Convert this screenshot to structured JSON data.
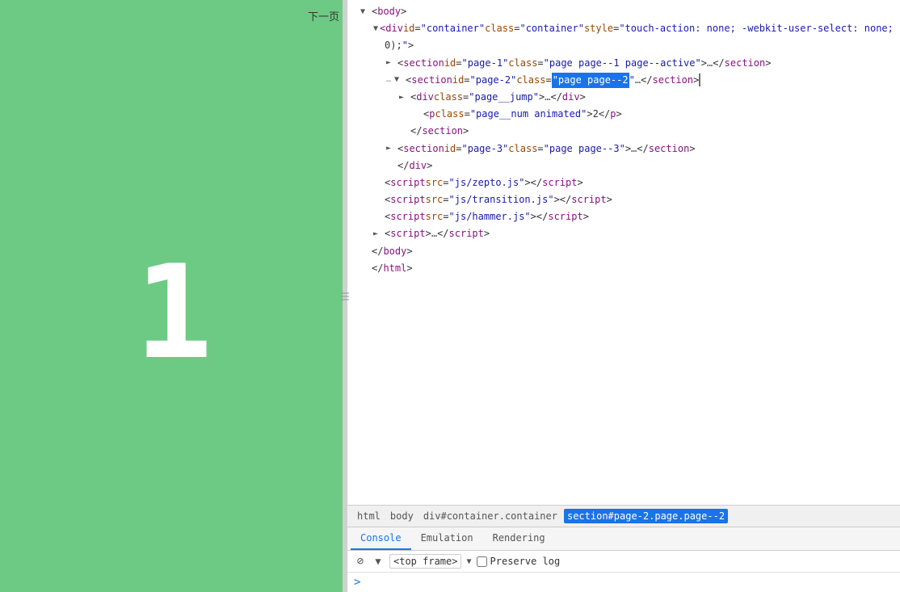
{
  "preview": {
    "background_color": "#6dca84",
    "page_number": "1",
    "next_page_btn": "下一页"
  },
  "devtools": {
    "dom_lines": [
      {
        "id": "line-body",
        "indent": "indent1",
        "triangle": "open",
        "marker": false,
        "html": "<span class='punctuation'>&lt;</span><span class='tag-name'>body</span><span class='punctuation'>&gt;</span>"
      },
      {
        "id": "line-div-container",
        "indent": "indent2",
        "triangle": "open",
        "marker": false,
        "html": "<span class='punctuation'>&lt;</span><span class='tag-name'>div</span> <span class='attr-name'>id</span><span class='punctuation'>=</span><span class='attr-value'>\"container\"</span> <span class='attr-name'>class</span><span class='punctuation'>=</span><span class='attr-value'>\"container\"</span> <span class='attr-name'>style</span><span class='punctuation'>=</span><span class='attr-value'>\"touch-action: none; -webkit-user-select: none; -webki</span>"
      },
      {
        "id": "line-0-close",
        "indent": "indent2",
        "triangle": "empty",
        "marker": false,
        "html": "<span class='punctuation'>0);</span><span class='attr-value'>\"</span><span class='punctuation'>&gt;</span>"
      },
      {
        "id": "line-section1",
        "indent": "indent3",
        "triangle": "closed",
        "marker": false,
        "html": "<span class='punctuation'>&lt;</span><span class='tag-name'>section</span> <span class='attr-name'>id</span><span class='punctuation'>=</span><span class='attr-value'>\"page-1\"</span> <span class='attr-name'>class</span><span class='punctuation'>=</span><span class='attr-value'>\"page page--1 page--active\"</span><span class='punctuation'>&gt;</span><span class='ellipsis'>…</span><span class='punctuation'>&lt;/</span><span class='tag-name'>section</span><span class='punctuation'>&gt;</span>"
      },
      {
        "id": "line-section2",
        "indent": "indent3",
        "triangle": "open",
        "marker": true,
        "html": "<span class='punctuation'>&lt;</span><span class='tag-name'>section</span> <span class='attr-name'>id</span><span class='punctuation'>=</span><span class='attr-value'>\"page-2\"</span> <span class='attr-name'>class</span><span class='punctuation'>=</span><span class='attr-value-highlight'>\"page page--2</span><span class='attr-value'>\"</span><span class='ellipsis'>…</span><span class='punctuation'>&lt;/</span><span class='tag-name'>section</span><span class='punctuation'>&gt;</span>",
        "highlighted": false
      },
      {
        "id": "line-div-jump",
        "indent": "indent4",
        "triangle": "closed",
        "marker": false,
        "html": "<span class='punctuation'>&lt;</span><span class='tag-name'>div</span> <span class='attr-name'>class</span><span class='punctuation'>=</span><span class='attr-value'>\"page__jump\"</span><span class='punctuation'>&gt;</span><span class='ellipsis'>…</span><span class='punctuation'>&lt;/</span><span class='tag-name'>div</span><span class='punctuation'>&gt;</span>"
      },
      {
        "id": "line-p-num",
        "indent": "indent5",
        "triangle": "empty",
        "marker": false,
        "html": "<span class='punctuation'>&lt;</span><span class='tag-name'>p</span> <span class='attr-name'>class</span><span class='punctuation'>=</span><span class='attr-value'>\"page__num animated\"</span><span class='punctuation'>&gt;</span>2<span class='punctuation'>&lt;/</span><span class='tag-name'>p</span><span class='punctuation'>&gt;</span>"
      },
      {
        "id": "line-section-close",
        "indent": "indent4",
        "triangle": "empty",
        "marker": false,
        "html": "<span class='punctuation'>&lt;/</span><span class='tag-name'>section</span><span class='punctuation'>&gt;</span>"
      },
      {
        "id": "line-section3",
        "indent": "indent3",
        "triangle": "closed",
        "marker": false,
        "html": "<span class='punctuation'>&lt;</span><span class='tag-name'>section</span> <span class='attr-name'>id</span><span class='punctuation'>=</span><span class='attr-value'>\"page-3\"</span> <span class='attr-name'>class</span><span class='punctuation'>=</span><span class='attr-value'>\"page page--3\"</span><span class='punctuation'>&gt;</span><span class='ellipsis'>…</span><span class='punctuation'>&lt;/</span><span class='tag-name'>section</span><span class='punctuation'>&gt;</span>"
      },
      {
        "id": "line-div-close",
        "indent": "indent3",
        "triangle": "empty",
        "marker": false,
        "html": "<span class='punctuation'>&lt;/</span><span class='tag-name'>div</span><span class='punctuation'>&gt;</span>"
      },
      {
        "id": "line-script1",
        "indent": "indent2",
        "triangle": "empty",
        "marker": false,
        "html": "<span class='punctuation'>&lt;</span><span class='tag-name'>script</span> <span class='attr-name'>src</span><span class='punctuation'>=</span><span class='attr-value'>\"js/zepto.js\"</span><span class='punctuation'>&gt;&lt;/</span><span class='tag-name'>script</span><span class='punctuation'>&gt;</span>"
      },
      {
        "id": "line-script2",
        "indent": "indent2",
        "triangle": "empty",
        "marker": false,
        "html": "<span class='punctuation'>&lt;</span><span class='tag-name'>script</span> <span class='attr-name'>src</span><span class='punctuation'>=</span><span class='attr-value'>\"js/transition.js\"</span><span class='punctuation'>&gt;&lt;/</span><span class='tag-name'>script</span><span class='punctuation'>&gt;</span>"
      },
      {
        "id": "line-script3",
        "indent": "indent2",
        "triangle": "empty",
        "marker": false,
        "html": "<span class='punctuation'>&lt;</span><span class='tag-name'>script</span> <span class='attr-name'>src</span><span class='punctuation'>=</span><span class='attr-value'>\"js/hammer.js\"</span><span class='punctuation'>&gt;&lt;/</span><span class='tag-name'>script</span><span class='punctuation'>&gt;</span>"
      },
      {
        "id": "line-script4",
        "indent": "indent2",
        "triangle": "closed",
        "marker": false,
        "html": "<span class='punctuation'>&lt;</span><span class='tag-name'>script</span><span class='punctuation'>&gt;</span><span class='ellipsis'>…</span><span class='punctuation'>&lt;/</span><span class='tag-name'>script</span><span class='punctuation'>&gt;</span>"
      },
      {
        "id": "line-body-close",
        "indent": "indent1",
        "triangle": "empty",
        "marker": false,
        "html": "<span class='punctuation'>&lt;/</span><span class='tag-name'>body</span><span class='punctuation'>&gt;</span>"
      },
      {
        "id": "line-html-close",
        "indent": "indent1",
        "triangle": "empty",
        "marker": false,
        "html": "<span class='punctuation'>&lt;/</span><span class='tag-name'>html</span><span class='punctuation'>&gt;</span>"
      }
    ],
    "breadcrumb": {
      "items": [
        "html",
        "body",
        "div#container.container",
        "section#page-2.page.page--2"
      ],
      "active_index": 3
    },
    "tabs": [
      {
        "label": "Console",
        "active": true
      },
      {
        "label": "Emulation",
        "active": false
      },
      {
        "label": "Rendering",
        "active": false
      }
    ],
    "toolbar": {
      "frame_selector": "<top frame>",
      "preserve_log_label": "Preserve log"
    },
    "console_prompt": ">"
  }
}
